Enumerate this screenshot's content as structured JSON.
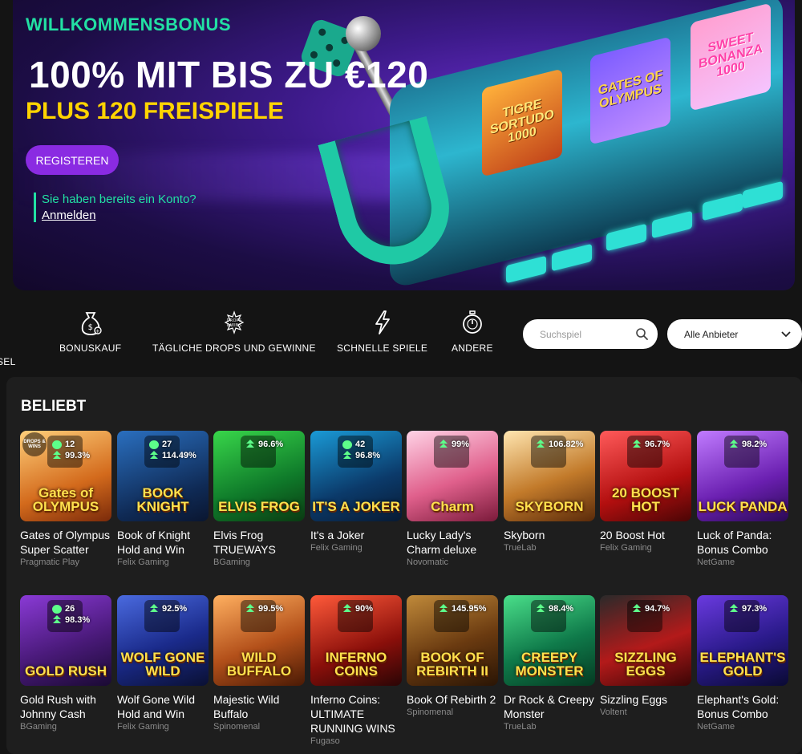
{
  "hero": {
    "welcome": "WILLKOMMENSBONUS",
    "headline": "100% MIT BIS ZU €120",
    "subline": "PLUS 120 FREISPIELE",
    "register_label": "REGISTEREN",
    "account_question": "Sie haben bereits ein Konto?",
    "login_label": "Anmelden",
    "reels": [
      "TIGRE SORTUDO 1000",
      "GATES OF OLYMPUS",
      "SWEET BONANZA 1000"
    ]
  },
  "categories": [
    {
      "label": "SEL",
      "icon": "carousel-icon"
    },
    {
      "label": "BONUSKAUF",
      "icon": "money-bag-icon"
    },
    {
      "label": "TÄGLICHE DROPS UND GEWINNE",
      "icon": "drops-wins-icon"
    },
    {
      "label": "SCHNELLE SPIELE",
      "icon": "lightning-icon"
    },
    {
      "label": "ANDERE",
      "icon": "stopwatch-icon"
    }
  ],
  "search": {
    "placeholder": "Suchspiel"
  },
  "provider_select": {
    "value": "Alle Anbieter"
  },
  "section": {
    "title": "BELIEBT"
  },
  "games": [
    {
      "name": "Gates of Olympus Super Scatter",
      "provider": "Pragmatic Play",
      "thumb_title": "Gates of OLYMPUS",
      "drops": "12",
      "rtp": "99.3%",
      "drops_tag": "DROPS & WINS"
    },
    {
      "name": "Book of Knight Hold and Win",
      "provider": "Felix Gaming",
      "thumb_title": "BOOK KNIGHT",
      "drops": "27",
      "rtp": "114.49%"
    },
    {
      "name": "Elvis Frog TRUEWAYS",
      "provider": "BGaming",
      "thumb_title": "ELVIS FROG",
      "rtp": "96.6%"
    },
    {
      "name": "It's a Joker",
      "provider": "Felix Gaming",
      "thumb_title": "IT'S A JOKER",
      "drops": "42",
      "rtp": "96.8%"
    },
    {
      "name": "Lucky Lady's Charm deluxe",
      "provider": "Novomatic",
      "thumb_title": "Charm",
      "rtp": "99%"
    },
    {
      "name": "Skyborn",
      "provider": "TrueLab",
      "thumb_title": "SKYBORN",
      "rtp": "106.82%"
    },
    {
      "name": "20 Boost Hot",
      "provider": "Felix Gaming",
      "thumb_title": "20 BOOST HOT",
      "rtp": "96.7%"
    },
    {
      "name": "Luck of Panda: Bonus Combo",
      "provider": "NetGame",
      "thumb_title": "LUCK PANDA",
      "rtp": "98.2%"
    },
    {
      "name": "Gold Rush with Johnny Cash",
      "provider": "BGaming",
      "thumb_title": "GOLD RUSH",
      "drops": "26",
      "rtp": "98.3%"
    },
    {
      "name": "Wolf Gone Wild Hold and Win",
      "provider": "Felix Gaming",
      "thumb_title": "WOLF GONE WILD",
      "rtp": "92.5%"
    },
    {
      "name": "Majestic Wild Buffalo",
      "provider": "Spinomenal",
      "thumb_title": "WILD BUFFALO",
      "rtp": "99.5%"
    },
    {
      "name": "Inferno Coins: ULTIMATE RUNNING WINS",
      "provider": "Fugaso",
      "thumb_title": "INFERNO COINS",
      "rtp": "90%"
    },
    {
      "name": "Book Of Rebirth 2",
      "provider": "Spinomenal",
      "thumb_title": "BOOK OF REBIRTH II",
      "rtp": "145.95%"
    },
    {
      "name": "Dr Rock & Creepy Monster",
      "provider": "TrueLab",
      "thumb_title": "CREEPY MONSTER",
      "rtp": "98.4%"
    },
    {
      "name": "Sizzling Eggs",
      "provider": "Voltent",
      "thumb_title": "SIZZLING EGGS",
      "rtp": "94.7%"
    },
    {
      "name": "Elephant's Gold: Bonus Combo",
      "provider": "NetGame",
      "thumb_title": "ELEPHANT'S GOLD",
      "rtp": "97.3%"
    }
  ],
  "colors": {
    "accent_green": "#22e0a3",
    "headline_yellow": "#ffd400",
    "button_purple": "#8a2be2",
    "panel_bg": "#1e1e1e"
  }
}
